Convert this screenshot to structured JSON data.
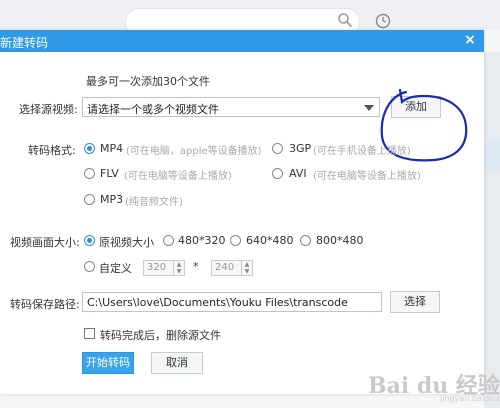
{
  "dialog": {
    "title": "新建转码",
    "close_label": "×"
  },
  "source": {
    "hint": "最多可一次添加30个文件",
    "label": "选择源视频:",
    "select_value": "请选择一个或多个视频文件",
    "add_button": "添加"
  },
  "format": {
    "label": "转码格式:",
    "options": [
      {
        "name": "MP4",
        "desc": "(可在电脑，apple等设备播放)",
        "checked": true
      },
      {
        "name": "3GP",
        "desc": "(可在手机设备上播放)",
        "checked": false
      },
      {
        "name": "FLV",
        "desc": "(可在电脑等设备上播放)",
        "checked": false
      },
      {
        "name": "AVI",
        "desc": "(可在电脑等设备上播放)",
        "checked": false
      },
      {
        "name": "MP3",
        "desc": "(纯音频文件)",
        "checked": false
      }
    ]
  },
  "size": {
    "label": "视频画面大小:",
    "options": [
      {
        "name": "原视频大小",
        "checked": true
      },
      {
        "name": "480*320",
        "checked": false
      },
      {
        "name": "640*480",
        "checked": false
      },
      {
        "name": "800*480",
        "checked": false
      },
      {
        "name": "自定义",
        "checked": false
      }
    ],
    "custom_width": "320",
    "custom_height": "240",
    "separator": "*"
  },
  "save": {
    "label": "转码保存路径:",
    "path": "C:\\Users\\love\\Documents\\Youku Files\\transcode",
    "browse_button": "选择"
  },
  "delete_source": {
    "label": "转码完成后，删除源文件",
    "checked": false
  },
  "actions": {
    "start": "开始转码",
    "cancel": "取消"
  },
  "watermark": {
    "text": "Bai du 经验",
    "sub": "jingyan.baidu.com"
  },
  "colors": {
    "title_bar": "#2f9ae8",
    "primary_button": "#3aa2ea",
    "annotation": "#1a2bb0"
  }
}
